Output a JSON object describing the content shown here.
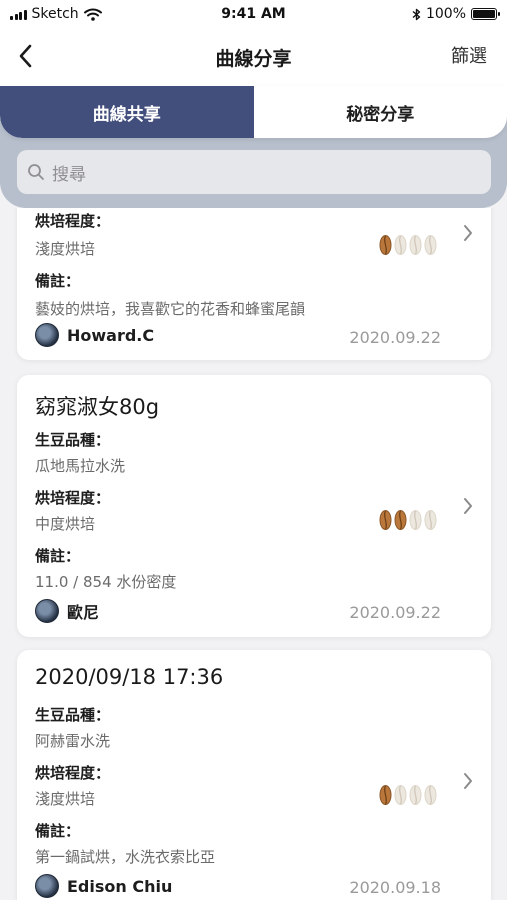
{
  "status_bar": {
    "carrier": "Sketch",
    "time": "9:41 AM",
    "battery_percent": "100%",
    "battery_level": 1.0
  },
  "nav": {
    "title": "曲線分享",
    "filter_label": "篩選"
  },
  "segments": [
    {
      "label": "曲線共享",
      "active": true
    },
    {
      "label": "秘密分享",
      "active": false
    }
  ],
  "search": {
    "placeholder": "搜尋"
  },
  "labels": {
    "bean_variety": "生豆品種：",
    "roast_level": "烘培程度：",
    "notes": "備註："
  },
  "colors": {
    "accent": "#424f7d",
    "header_bg": "#b7bfcd",
    "bean_filled": "#b9773b",
    "bean_empty": "#ece7df"
  },
  "cards": [
    {
      "title": "",
      "bean_variety": "",
      "roast_level": "淺度烘培",
      "roast_beans": 1,
      "notes": "藝妓的烘培，我喜歡它的花香和蜂蜜尾韻",
      "author": "Howard.C",
      "date": "2020.09.22"
    },
    {
      "title": "窈窕淑女80g",
      "bean_variety": "瓜地馬拉水洗",
      "roast_level": "中度烘培",
      "roast_beans": 2,
      "notes": "11.0 / 854 水份密度",
      "author": "歐尼",
      "date": "2020.09.22"
    },
    {
      "title": "2020/09/18 17:36",
      "bean_variety": "阿赫雷水洗",
      "roast_level": "淺度烘培",
      "roast_beans": 1,
      "notes": "第一鍋試烘，水洗衣索比亞",
      "author": "Edison Chiu",
      "date": "2020.09.18"
    }
  ]
}
